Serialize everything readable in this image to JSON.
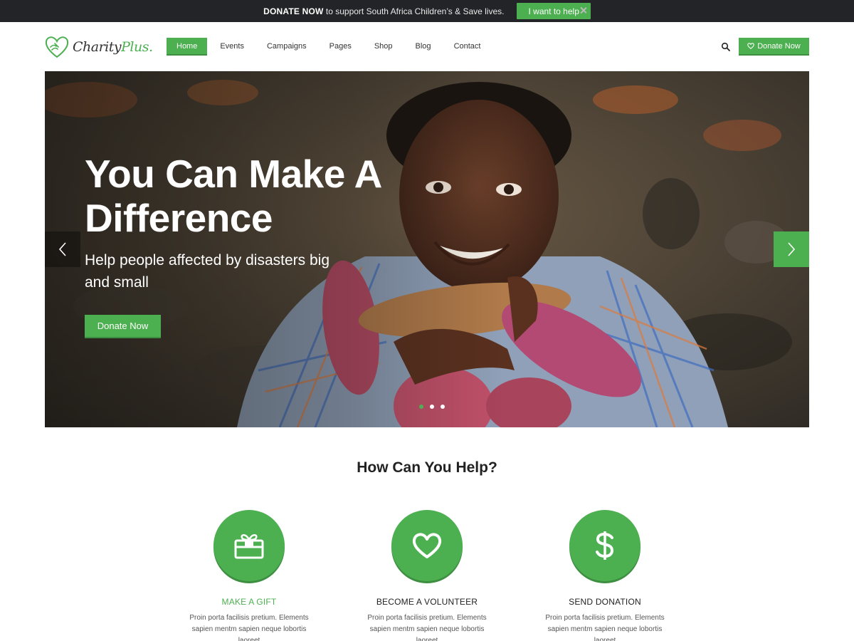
{
  "announcement": {
    "bold": "DONATE NOW",
    "text": " to support South Africa Children’s & Save lives.",
    "button": "I want to help"
  },
  "brand": {
    "name_part1": "Charity",
    "name_part2": "Plus.",
    "accent_color": "#4caf50"
  },
  "nav": {
    "items": [
      {
        "label": "Home",
        "active": true
      },
      {
        "label": "Events"
      },
      {
        "label": "Campaigns"
      },
      {
        "label": "Pages"
      },
      {
        "label": "Shop"
      },
      {
        "label": "Blog"
      },
      {
        "label": "Contact"
      }
    ],
    "search_icon": "search-icon",
    "donate_button": "Donate Now",
    "donate_icon": "heart-icon"
  },
  "hero": {
    "title": "You Can Make A Difference",
    "subtitle": "Help people affected by disasters big and small",
    "cta": "Donate Now",
    "slides": 3,
    "active_slide": 1
  },
  "help": {
    "title": "How Can You Help?",
    "features": [
      {
        "icon": "gift-icon",
        "title": "MAKE A GIFT",
        "desc": "Proin porta facilisis pretium. Elements sapien  mentm sapien neque lobortis laoreet",
        "highlight": true
      },
      {
        "icon": "heart-icon",
        "title": "BECOME A VOLUNTEER",
        "desc": "Proin porta facilisis pretium. Elements sapien  mentm sapien neque lobortis laoreet"
      },
      {
        "icon": "dollar-icon",
        "title": "SEND DONATION",
        "desc": "Proin porta facilisis pretium. Elements sapien  mentm sapien neque lobortis laoreet"
      }
    ]
  }
}
